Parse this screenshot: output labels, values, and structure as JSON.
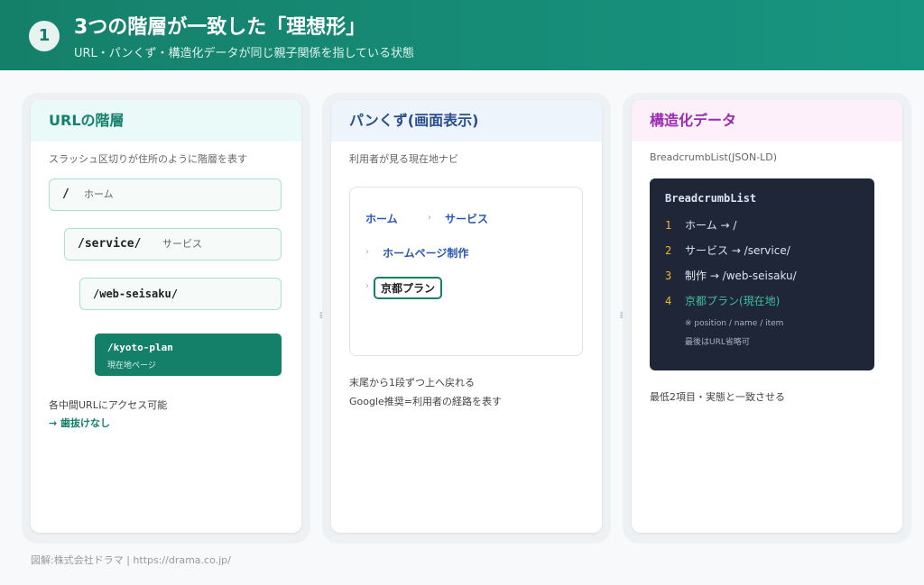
{
  "header": {
    "step": "1",
    "title": "3つの階層が一致した「理想形」",
    "subtitle": "URL・パンくず・構造化データが同じ親子関係を指している状態"
  },
  "url_card": {
    "title": "URLの階層",
    "description": "スラッシュ区切りが住所のように階層を表す",
    "levels": [
      {
        "path": "/",
        "label": "ホーム"
      },
      {
        "path": "/service/",
        "label": "サービス"
      },
      {
        "path": "/web-seisaku/",
        "label": ""
      }
    ],
    "current": {
      "path": "/kyoto-plan",
      "label": "現在地ページ"
    },
    "note": "各中間URLにアクセス可能",
    "note_emphasis": "→ 歯抜けなし"
  },
  "breadcrumb_card": {
    "title": "パンくず(画面表示)",
    "description": "利用者が見る現在地ナビ",
    "items": [
      "ホーム",
      "サービス",
      "ホームページ制作"
    ],
    "separator": "›",
    "current": "京都プラン",
    "note": "末尾から1段ずつ上へ戻れる",
    "note2": "Google推奨=利用者の経路を表す"
  },
  "structured_card": {
    "title": "構造化データ",
    "description": "BreadcrumbList(JSON-LD)",
    "code_title": "BreadcrumbList",
    "rows": [
      {
        "num": "1",
        "text": "ホーム → /"
      },
      {
        "num": "2",
        "text": "サービス → /service/"
      },
      {
        "num": "3",
        "text": "制作 → /web-seisaku/"
      },
      {
        "num": "4",
        "text": "京都プラン(現在地)"
      }
    ],
    "code_note1": "※ position / name / item",
    "code_note2": "最後はURL省略可",
    "note": "最低2項目・実態と一致させる"
  },
  "equiv_symbol": "≡",
  "footer": "図解:株式会社ドラマ | https://drama.co.jp/",
  "colors": {
    "header_green": "#15806a",
    "breadcrumb_blue": "#2a57b5",
    "structured_purple": "#9b2bb0",
    "code_bg": "#1e2637",
    "number_yellow": "#f0b429"
  }
}
